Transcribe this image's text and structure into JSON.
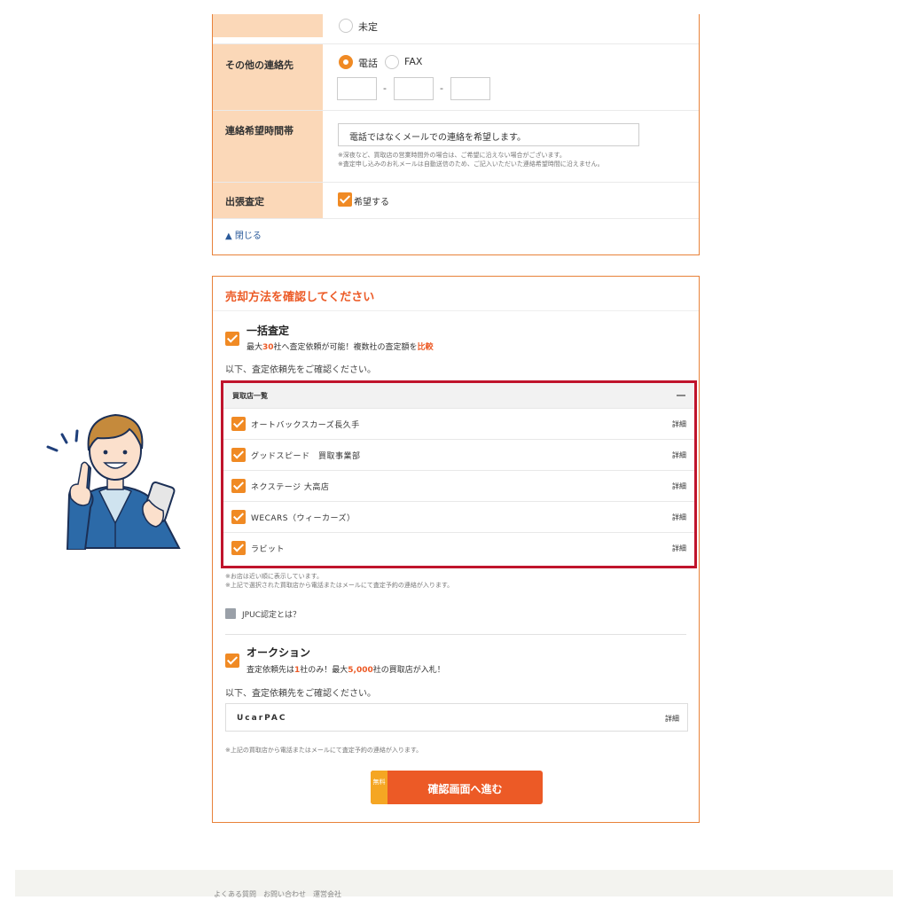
{
  "form": {
    "undecided_label": "未定",
    "other_contact_label": "その他の連絡先",
    "phone_label": "電話",
    "fax_label": "FAX",
    "dash": "-",
    "contact_time_label": "連絡希望時間帯",
    "contact_time_value": "電話ではなくメールでの連絡を希望します。",
    "contact_time_note1": "※深夜など、買取店の営業時間外の場合は、ご希望に沿えない場合がございます。",
    "contact_time_note2": "※査定申し込みのお礼メールは自動送信のため、ご記入いただいた連絡希望時間に沿えません。",
    "visit_label": "出張査定",
    "visit_option": "希望する",
    "close_link": "▲ 閉じる"
  },
  "sale": {
    "title": "売却方法を確認してください",
    "bulk": {
      "title": "一括査定",
      "sub_pre": "最大",
      "sub_num": "30",
      "sub_mid": "社へ査定依頼が可能！複数社の査定額を",
      "sub_em": "比較",
      "confirm": "以下、査定依頼先をご確認ください。"
    },
    "list": {
      "header": "買取店一覧",
      "shops": [
        {
          "name": "オートバックスカーズ長久手",
          "detail": "詳細"
        },
        {
          "name": "グッドスピード　買取事業部",
          "detail": "詳細"
        },
        {
          "name": "ネクステージ 大高店",
          "detail": "詳細"
        },
        {
          "name": "WECARS（ウィーカーズ）",
          "detail": "詳細"
        },
        {
          "name": "ラビット",
          "detail": "詳細"
        }
      ]
    },
    "notes1": "※お店は近い順に表示しています。",
    "notes2": "※上記で選択された買取店から電話またはメールにて査定予約の連絡が入ります。",
    "jpuc_link": "JPUC認定とは？",
    "auction": {
      "title": "オークション",
      "sub_pre": "査定依頼先は",
      "sub_num": "1",
      "sub_mid": "社のみ！最大",
      "sub_num2": "5,000",
      "sub_post": "社の買取店が入札！",
      "confirm": "以下、査定依頼先をご確認ください。",
      "shop": "UcarPAC",
      "detail": "詳細",
      "note": "※上記の買取店から電話またはメールにて査定予約の連絡が入ります。"
    },
    "cta": {
      "free": "無料",
      "label": "確認画面へ進む"
    }
  },
  "footer": {
    "text": "よくある質問　お問い合わせ　運営会社"
  },
  "colors": {
    "accent": "#ec5a26",
    "checkbox": "#f08a24",
    "highlight_border": "#c0142c",
    "label_bg": "#fbd8b8"
  }
}
